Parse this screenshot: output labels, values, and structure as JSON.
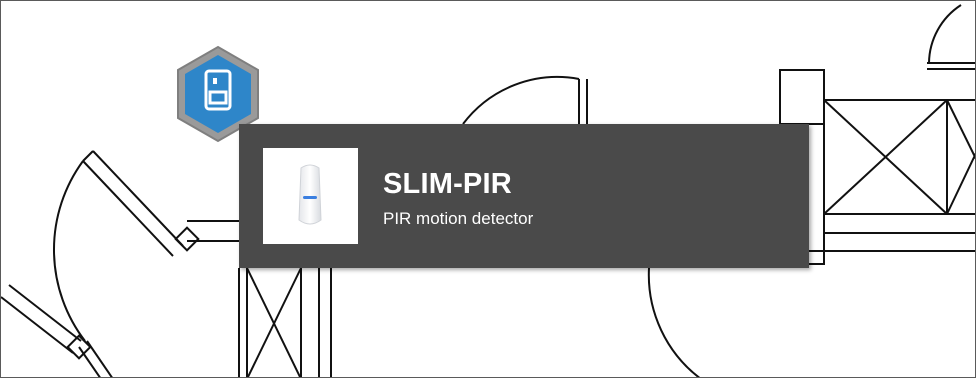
{
  "device": {
    "name": "SLIM-PIR",
    "description": "PIR motion detector",
    "marker_icon": "door-sensor-icon",
    "marker_color": "#2e86c9",
    "marker_ring_color": "#8c8c8c"
  },
  "tooltip": {
    "background": "#4a4a4a",
    "thumbnail": "motion-detector-product-image"
  }
}
